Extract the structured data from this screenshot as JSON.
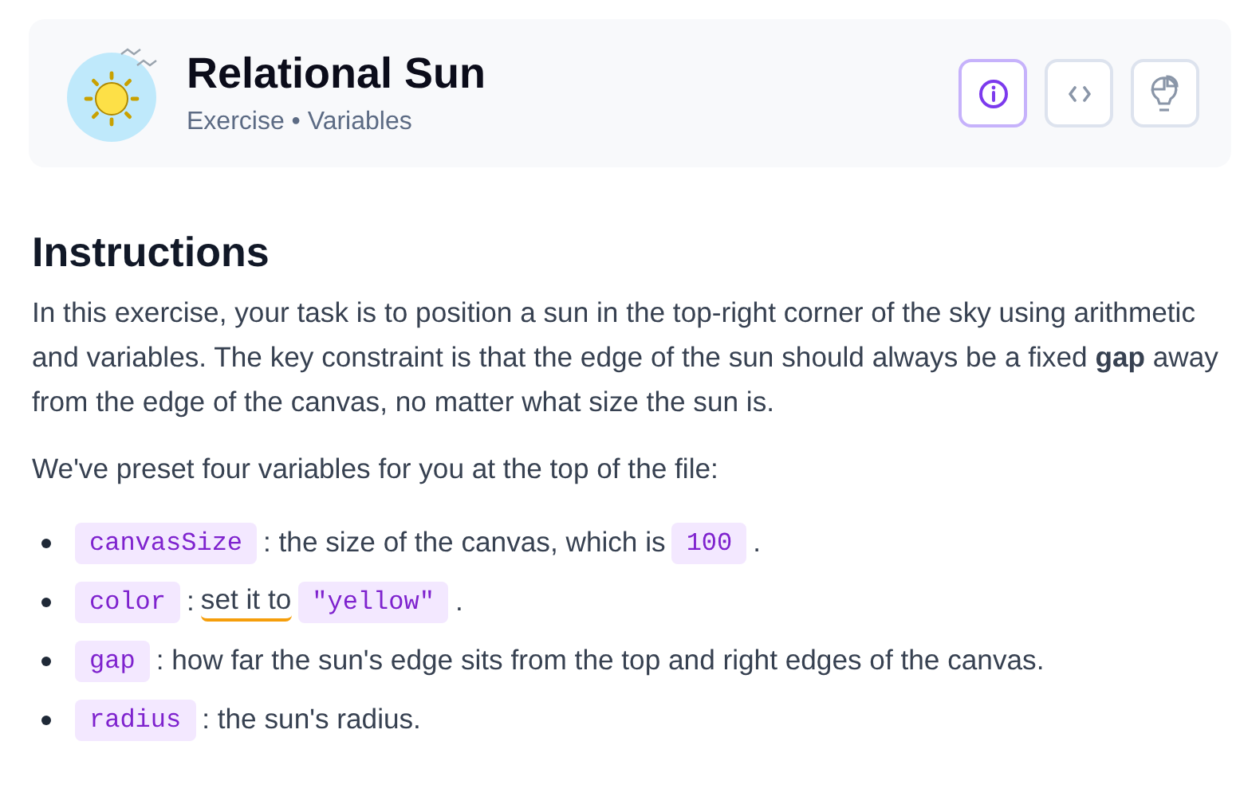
{
  "header": {
    "title": "Relational Sun",
    "subtitle": "Exercise • Variables",
    "buttons": [
      {
        "kind": "info",
        "selected": true
      },
      {
        "kind": "code",
        "selected": false
      },
      {
        "kind": "hint",
        "selected": false
      }
    ]
  },
  "instructions": {
    "heading": "Instructions",
    "paragraphs": [
      "In this exercise, your task is to position a sun in the top-right corner of the sky using arithmetic and variables. The key constraint is that the edge of the sun should always be a fixed **gap** away from the edge of the canvas, no matter what size the sun is.",
      "We've preset four variables for you at the top of the file:"
    ],
    "bullets": [
      [
        {
          "kind": "code",
          "text": "canvasSize"
        },
        {
          "kind": "text",
          "text": ": the size of the canvas, which is"
        },
        {
          "kind": "code",
          "text": "100"
        },
        {
          "kind": "text",
          "text": "."
        }
      ],
      [
        {
          "kind": "code",
          "text": "color"
        },
        {
          "kind": "text",
          "text": ":"
        },
        {
          "kind": "underlined",
          "text": "set it to"
        },
        {
          "kind": "code",
          "text": "\"yellow\""
        },
        {
          "kind": "text",
          "text": "."
        }
      ],
      [
        {
          "kind": "code",
          "text": "gap"
        },
        {
          "kind": "text",
          "text": ": how far the sun's edge sits from the top and right edges of the canvas."
        }
      ],
      [
        {
          "kind": "code",
          "text": "radius"
        },
        {
          "kind": "text",
          "text": ": the sun's radius."
        }
      ]
    ]
  }
}
